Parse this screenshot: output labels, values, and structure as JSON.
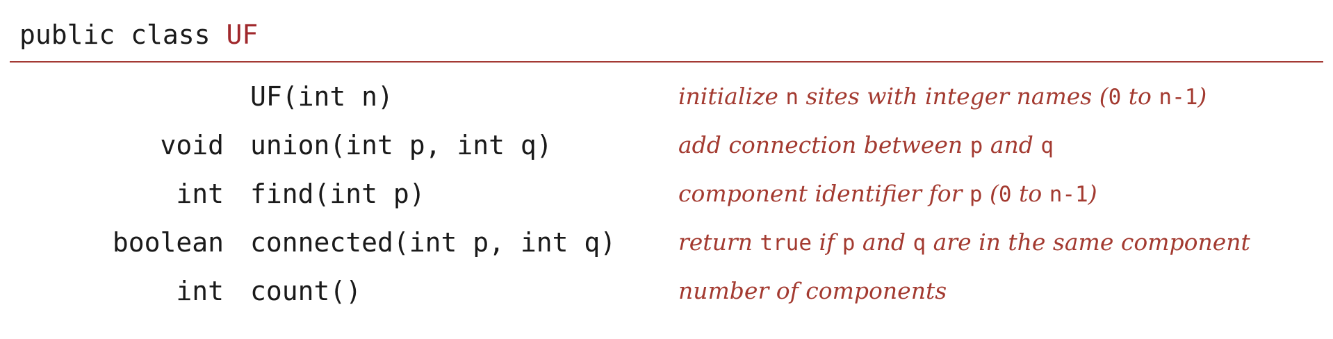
{
  "header": {
    "keyword": "public class",
    "class_name": "UF"
  },
  "rows": [
    {
      "ret": "",
      "sig": "UF(int n)",
      "desc": [
        {
          "t": "initialize "
        },
        {
          "t": "n",
          "code": true
        },
        {
          "t": " sites with integer names ("
        },
        {
          "t": "0",
          "code": true
        },
        {
          "t": " to "
        },
        {
          "t": "n-1",
          "code": true
        },
        {
          "t": ")"
        }
      ]
    },
    {
      "ret": "void",
      "sig": "union(int p, int q)",
      "desc": [
        {
          "t": "add connection between "
        },
        {
          "t": "p",
          "code": true
        },
        {
          "t": " and "
        },
        {
          "t": "q",
          "code": true
        }
      ]
    },
    {
      "ret": "int",
      "sig": "find(int p)",
      "desc": [
        {
          "t": "component identifier for "
        },
        {
          "t": "p",
          "code": true
        },
        {
          "t": " ("
        },
        {
          "t": "0",
          "code": true
        },
        {
          "t": " to "
        },
        {
          "t": "n-1",
          "code": true
        },
        {
          "t": ")"
        }
      ]
    },
    {
      "ret": "boolean",
      "sig": "connected(int p, int q)",
      "desc": [
        {
          "t": "return "
        },
        {
          "t": "true",
          "code": true
        },
        {
          "t": " if "
        },
        {
          "t": "p",
          "code": true
        },
        {
          "t": " and "
        },
        {
          "t": "q",
          "code": true
        },
        {
          "t": " are in the same component"
        }
      ]
    },
    {
      "ret": "int",
      "sig": "count()",
      "desc": [
        {
          "t": "number of components"
        }
      ]
    }
  ]
}
